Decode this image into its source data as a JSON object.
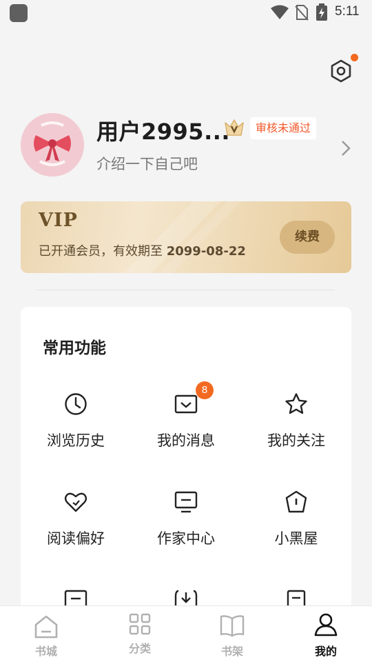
{
  "status_bar": {
    "time": "5:11",
    "icons": [
      "app-icon",
      "wifi-icon",
      "no-sim-icon",
      "battery-charging-icon"
    ]
  },
  "header": {
    "settings_icon": "settings-hexagon-icon",
    "settings_has_notification": true
  },
  "profile": {
    "username": "用户2995...",
    "badge": "审核未通过",
    "bio": "介绍一下自己吧",
    "crown_icon": "vip-crown-icon"
  },
  "vip": {
    "title": "VIP",
    "description_prefix": "已开通会员，有效期至",
    "expiry_date": "2099-08-22",
    "renew_label": "续费"
  },
  "functions": {
    "title": "常用功能",
    "items": [
      {
        "label": "浏览历史",
        "icon": "clock-icon"
      },
      {
        "label": "我的消息",
        "icon": "message-icon",
        "badge": "8"
      },
      {
        "label": "我的关注",
        "icon": "star-icon"
      },
      {
        "label": "阅读偏好",
        "icon": "heart-icon"
      },
      {
        "label": "作家中心",
        "icon": "monitor-icon"
      },
      {
        "label": "小黑屋",
        "icon": "pentagon-alert-icon"
      },
      {
        "label": "",
        "icon": "document-icon"
      },
      {
        "label": "",
        "icon": "download-icon"
      },
      {
        "label": "",
        "icon": "note-icon"
      }
    ]
  },
  "bottom_nav": {
    "items": [
      {
        "label": "书城",
        "icon": "home-icon",
        "active": false
      },
      {
        "label": "分类",
        "icon": "grid-icon",
        "active": false
      },
      {
        "label": "书架",
        "icon": "book-icon",
        "active": false
      },
      {
        "label": "我的",
        "icon": "profile-icon",
        "active": true
      }
    ]
  },
  "colors": {
    "accent": "#f26a21",
    "badge_text": "#f0592b",
    "vip_text": "#6e5229",
    "background": "#f4f4f4"
  }
}
